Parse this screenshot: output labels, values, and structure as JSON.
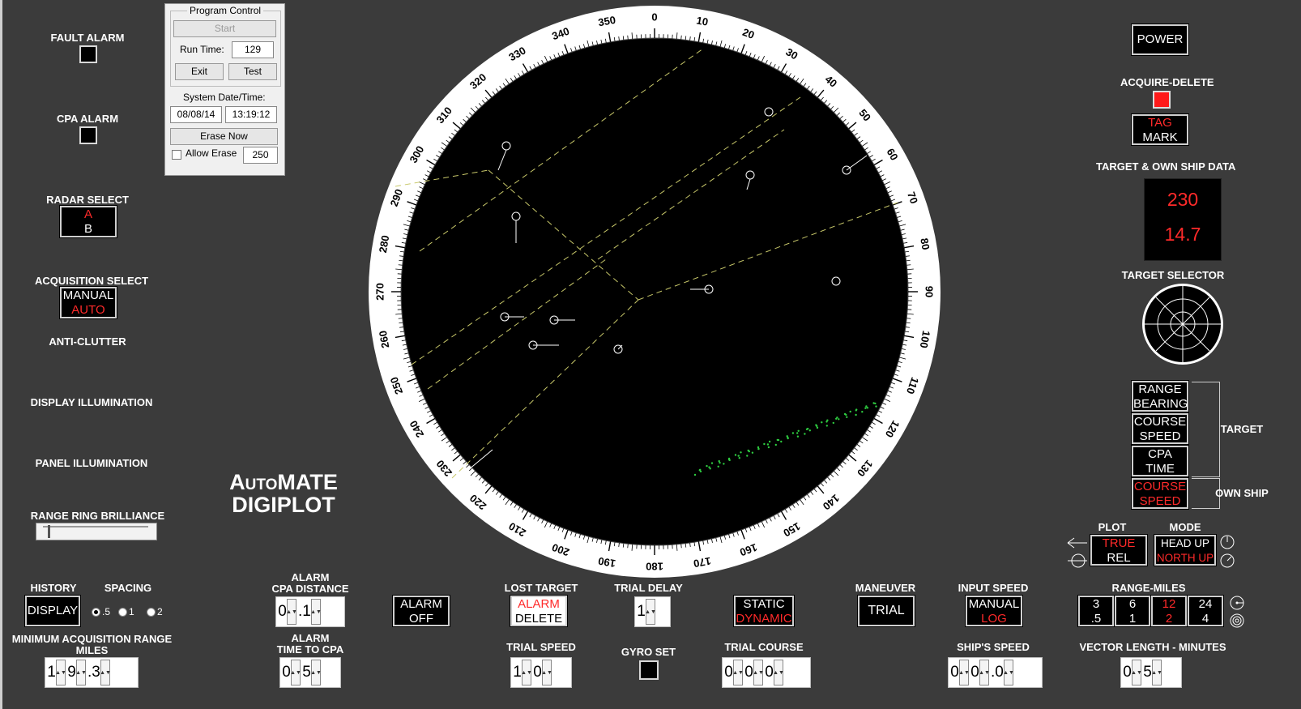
{
  "left_panel": {
    "fault_alarm": "FAULT ALARM",
    "cpa_alarm": "CPA ALARM",
    "radar_select": "RADAR SELECT",
    "radar_a": "A",
    "radar_b": "B",
    "acquisition_select": "ACQUISITION SELECT",
    "acq_manual": "MANUAL",
    "acq_auto": "AUTO",
    "anti_clutter": "ANTI-CLUTTER",
    "display_illumination": "DISPLAY ILLUMINATION",
    "panel_illumination": "PANEL ILLUMINATION",
    "range_ring_brilliance": "RANGE RING BRILLIANCE"
  },
  "program_control": {
    "title": "Program Control",
    "start": "Start",
    "run_time_label": "Run Time:",
    "run_time_value": "129",
    "exit": "Exit",
    "test": "Test",
    "system_datetime_label": "System Date/Time:",
    "date": "08/08/14",
    "time": "13:19:12",
    "erase_now": "Erase Now",
    "allow_erase": "Allow Erase",
    "allow_erase_value": "250"
  },
  "logo": {
    "line1": "AutoMATE",
    "line2": "DIGIPLOT"
  },
  "compass": {
    "labels": [
      "0",
      "10",
      "20",
      "30",
      "40",
      "50",
      "60",
      "70",
      "80",
      "90",
      "100",
      "110",
      "120",
      "130",
      "140",
      "150",
      "160",
      "170",
      "180",
      "190",
      "200",
      "210",
      "220",
      "230",
      "240",
      "250",
      "260",
      "270",
      "280",
      "290",
      "300",
      "310",
      "320",
      "330",
      "340",
      "350"
    ]
  },
  "right_panel": {
    "power": "POWER",
    "acquire_delete": "ACQUIRE-DELETE",
    "tag": "TAG",
    "mark": "MARK",
    "target_own_ship_data": "TARGET & OWN SHIP DATA",
    "data_value1": "230",
    "data_value2": "14.7",
    "target_selector": "TARGET SELECTOR",
    "range": "RANGE",
    "bearing": "BEARING",
    "course1": "COURSE",
    "speed1": "SPEED",
    "cpa": "CPA",
    "time": "TIME",
    "course2": "COURSE",
    "speed2": "SPEED",
    "target": "TARGET",
    "own_ship": "OWN SHIP",
    "plot": "PLOT",
    "plot_true": "TRUE",
    "plot_rel": "REL",
    "mode": "MODE",
    "head_up": "HEAD UP",
    "north_up": "NORTH UP"
  },
  "bottom": {
    "history": "HISTORY",
    "display": "DISPLAY",
    "spacing": "SPACING",
    "spacing_opts": [
      ".5",
      "1",
      "2"
    ],
    "min_acq_range": "MINIMUM ACQUISITION RANGE",
    "miles": "MILES",
    "min_acq_digits": [
      "1",
      "9",
      ".",
      "3"
    ],
    "alarm_cpa_distance_1": "ALARM",
    "alarm_cpa_distance_2": "CPA DISTANCE",
    "cpa_dist_digits": [
      "0",
      ".",
      "1"
    ],
    "alarm_time_cpa_1": "ALARM",
    "alarm_time_cpa_2": "TIME TO CPA",
    "time_cpa_digits": [
      "0",
      "5"
    ],
    "alarm_off_1": "ALARM",
    "alarm_off_2": "OFF",
    "lost_target": "LOST TARGET",
    "lt_alarm": "ALARM",
    "lt_delete": "DELETE",
    "trial_speed": "TRIAL SPEED",
    "trial_speed_digits": [
      "1",
      "0"
    ],
    "trial_delay": "TRIAL DELAY",
    "trial_delay_digits": [
      "1"
    ],
    "gyro_set": "GYRO SET",
    "static": "STATIC",
    "dynamic": "DYNAMIC",
    "trial_course": "TRIAL COURSE",
    "trial_course_digits": [
      "0",
      "0",
      "0"
    ],
    "maneuver": "MANEUVER",
    "trial": "TRIAL",
    "input_speed": "INPUT SPEED",
    "is_manual": "MANUAL",
    "is_log": "LOG",
    "ships_speed": "SHIP'S SPEED",
    "ships_speed_digits": [
      "0",
      "0",
      ".",
      "0"
    ],
    "range_miles": "RANGE-MILES",
    "range_buttons": [
      [
        "3",
        ".5"
      ],
      [
        "6",
        "1"
      ],
      [
        "12",
        "2"
      ],
      [
        "24",
        "4"
      ]
    ],
    "vector_length": "VECTOR LENGTH - MINUTES",
    "vector_digits": [
      "0",
      "5"
    ]
  },
  "colors": {
    "panel": "#3b3b3b",
    "red": "#ff2a2a",
    "green": "#2ecc40",
    "yellow": "#d8d86a"
  }
}
